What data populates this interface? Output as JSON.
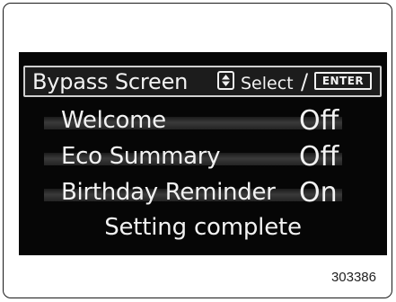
{
  "header": {
    "title": "Bypass Screen",
    "select_label": "Select",
    "separator": "/",
    "enter_label": "ENTER"
  },
  "menu": {
    "items": [
      {
        "label": "Welcome",
        "value": "Off"
      },
      {
        "label": "Eco Summary",
        "value": "Off"
      },
      {
        "label": "Birthday Reminder",
        "value": "On"
      }
    ]
  },
  "status": {
    "message": "Setting complete"
  },
  "figure": {
    "number": "303386"
  },
  "icons": {
    "updown": "up-down-arrows-icon"
  },
  "colors": {
    "screen_bg": "#060606",
    "text": "#f2f2f2",
    "frame_border": "#1a1a1a"
  }
}
